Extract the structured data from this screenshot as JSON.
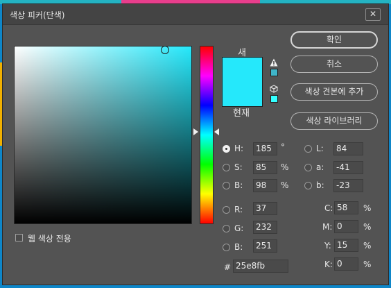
{
  "window": {
    "title": "색상 피커(단색)",
    "close_glyph": "✕"
  },
  "swatches": {
    "new_label": "새",
    "current_label": "현재",
    "new_color": "#25e8fb",
    "current_color": "#25e8fb",
    "out_of_gamut_swatch": "#3fb5c9",
    "web_safe_swatch": "#33ffff"
  },
  "buttons": {
    "ok": "확인",
    "cancel": "취소",
    "add_to_swatches": "색상 견본에 추가",
    "color_libraries": "색상 라이브러리"
  },
  "hsb": {
    "h": {
      "label": "H:",
      "value": "185",
      "unit": "°"
    },
    "s": {
      "label": "S:",
      "value": "85",
      "unit": "%"
    },
    "b": {
      "label": "B:",
      "value": "98",
      "unit": "%"
    }
  },
  "lab": {
    "l": {
      "label": "L:",
      "value": "84"
    },
    "a": {
      "label": "a:",
      "value": "-41"
    },
    "b": {
      "label": "b:",
      "value": "-23"
    }
  },
  "rgb": {
    "r": {
      "label": "R:",
      "value": "37"
    },
    "g": {
      "label": "G:",
      "value": "232"
    },
    "b": {
      "label": "B:",
      "value": "251"
    }
  },
  "cmyk": {
    "c": {
      "label": "C:",
      "value": "58",
      "unit": "%"
    },
    "m": {
      "label": "M:",
      "value": "0",
      "unit": "%"
    },
    "y": {
      "label": "Y:",
      "value": "15",
      "unit": "%"
    },
    "k": {
      "label": "K:",
      "value": "0",
      "unit": "%"
    }
  },
  "hex": {
    "label": "#",
    "value": "25e8fb"
  },
  "web_only": {
    "label": "웹 색상 전용",
    "checked": false
  },
  "selected_mode": "H"
}
